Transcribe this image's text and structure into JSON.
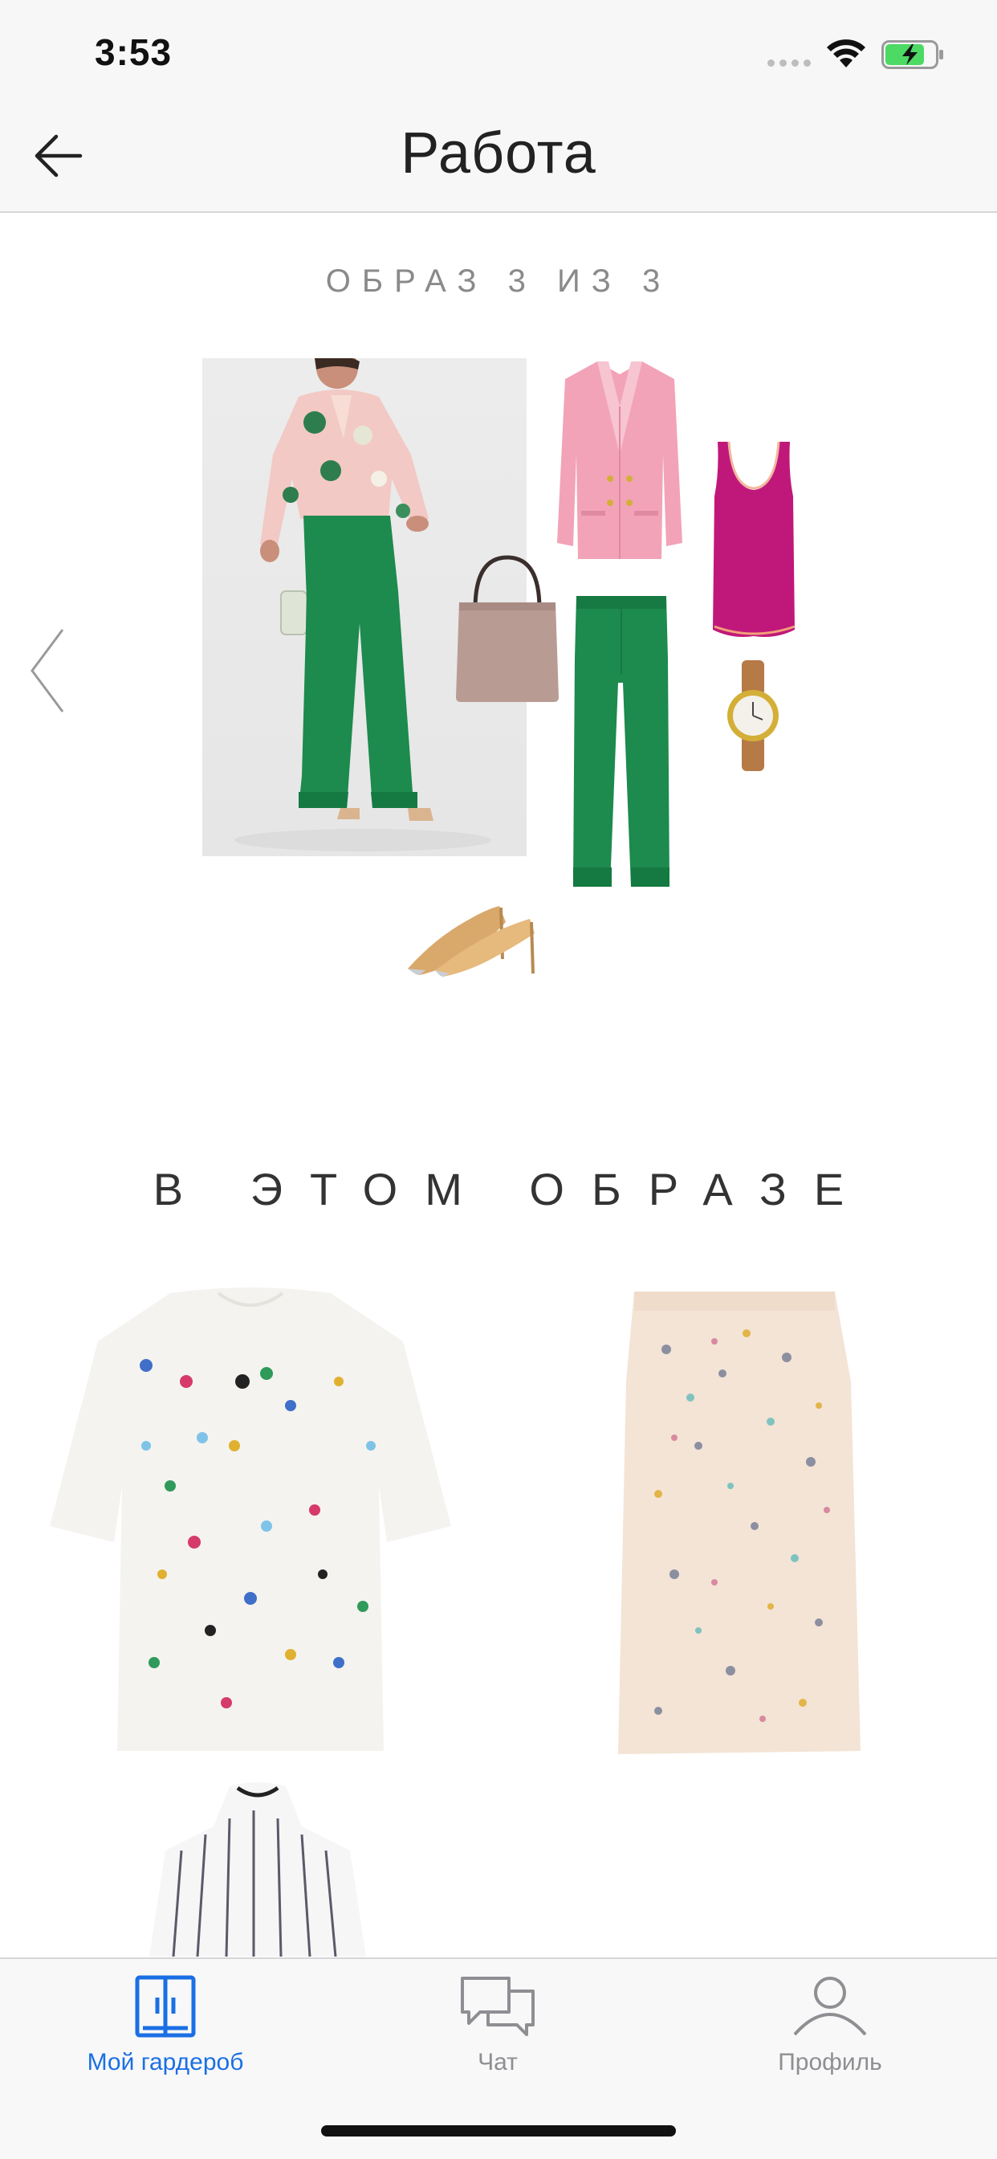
{
  "status_bar": {
    "time": "3:53"
  },
  "nav": {
    "title": "Работа"
  },
  "look": {
    "counter": "ОБРАЗ 3 ИЗ 3"
  },
  "section": {
    "title": "В ЭТОМ ОБРАЗЕ"
  },
  "tabs": [
    {
      "label": "Мой гардероб",
      "icon": "wardrobe-icon",
      "active": true
    },
    {
      "label": "Чат",
      "icon": "chat-icon",
      "active": false
    },
    {
      "label": "Профиль",
      "icon": "profile-icon",
      "active": false
    }
  ],
  "colors": {
    "accent": "#1b6fe4",
    "inactive": "#8e8e93",
    "battery_green": "#4cd964",
    "pants_green": "#1d8a4e",
    "blazer_pink": "#f2a3b8",
    "top_magenta": "#c0187a",
    "bag_taupe": "#b89c94",
    "skirt_beige": "#f3e4d6"
  }
}
